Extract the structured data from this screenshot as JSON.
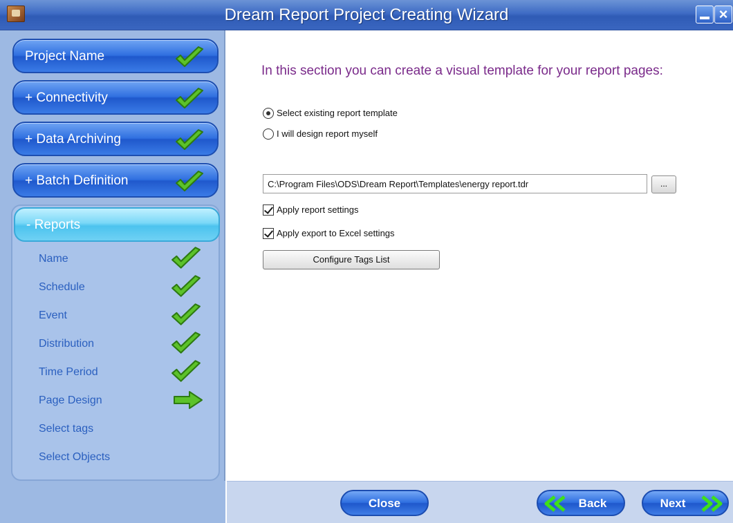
{
  "window": {
    "title": "Dream Report Project Creating Wizard"
  },
  "sidebar": {
    "steps": [
      {
        "label": "Project Name",
        "status": "done"
      },
      {
        "label": "+ Connectivity",
        "status": "done"
      },
      {
        "label": "+ Data Archiving",
        "status": "done"
      },
      {
        "label": "+ Batch Definition",
        "status": "done"
      }
    ],
    "reports": {
      "label": "- Reports",
      "items": [
        {
          "label": "Name",
          "status": "done"
        },
        {
          "label": "Schedule",
          "status": "done"
        },
        {
          "label": "Event",
          "status": "done"
        },
        {
          "label": "Distribution",
          "status": "done"
        },
        {
          "label": "Time Period",
          "status": "done"
        },
        {
          "label": "Page Design",
          "status": "current"
        },
        {
          "label": "Select tags",
          "status": "pending"
        },
        {
          "label": "Select Objects",
          "status": "pending"
        }
      ]
    }
  },
  "main": {
    "intro": "In this section you can create a visual template for your report pages:",
    "radio_existing": "Select existing report template",
    "radio_design": "I will design report myself",
    "selected_option": "existing",
    "template_path": "C:\\Program Files\\ODS\\Dream Report\\Templates\\energy report.tdr",
    "browse_label": "...",
    "apply_report_settings": "Apply report settings",
    "apply_excel_settings": "Apply export to Excel settings",
    "configure_tags": "Configure Tags List"
  },
  "footer": {
    "close": "Close",
    "back": "Back",
    "next": "Next"
  },
  "colors": {
    "check_green": "#5cc22a",
    "intro_purple": "#7a2a8a",
    "nav_blue": "#2f6fe0"
  }
}
